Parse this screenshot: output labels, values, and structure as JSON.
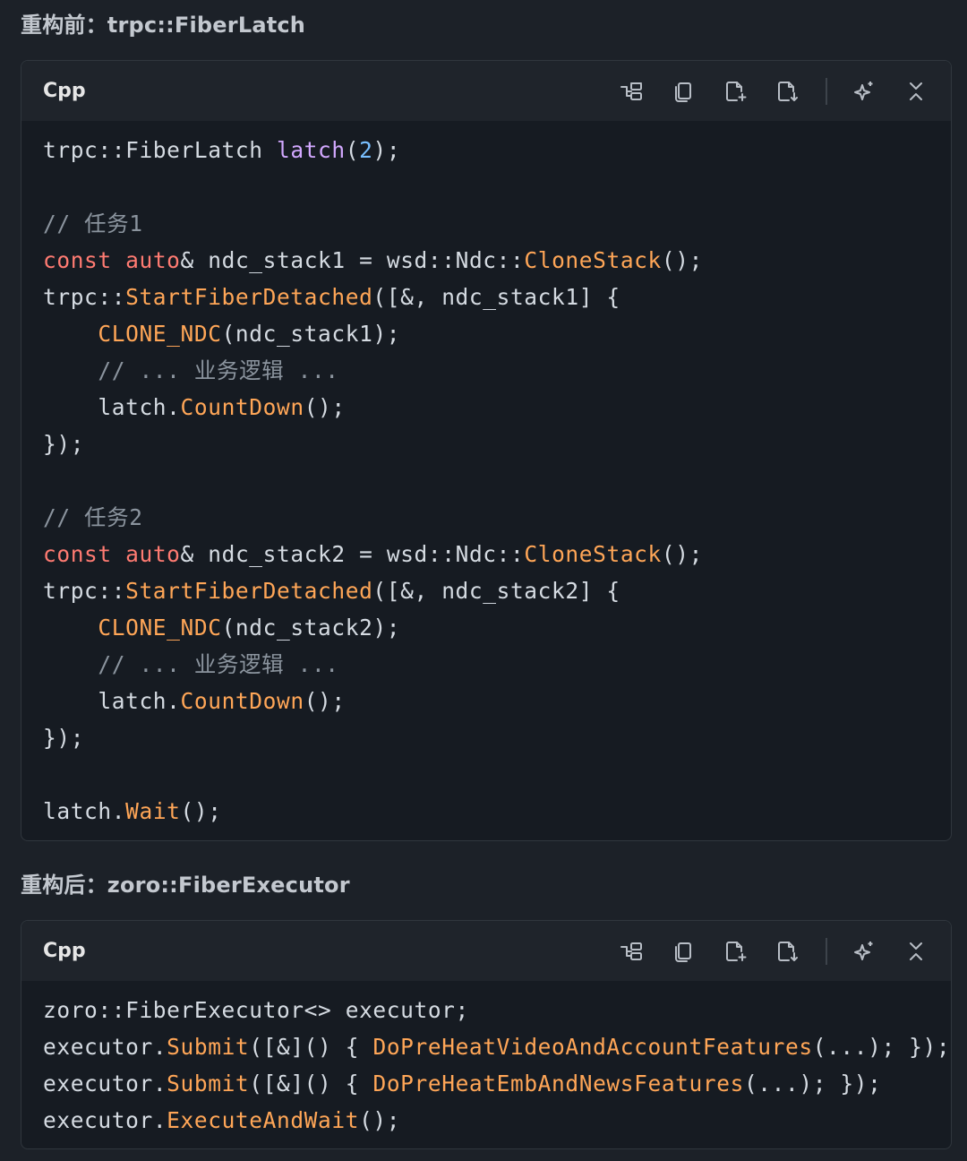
{
  "section1": {
    "title": "重构前：trpc::FiberLatch"
  },
  "section2": {
    "title": "重构后：zoro::FiberExecutor"
  },
  "code_block": {
    "language": "Cpp",
    "toolbar_icons": [
      "outline-icon",
      "copy-icon",
      "insert-file-icon",
      "download-file-icon",
      "sparkle-icon",
      "collapse-icon"
    ]
  },
  "colors": {
    "background": "#1c2128",
    "code_background": "#161b22",
    "keyword": "#ff7b72",
    "function": "#ffa657",
    "type": "#d2a8ff",
    "number": "#79c0ff",
    "comment": "#8b949e"
  },
  "code1": [
    {
      "t": "trpc::FiberLatch latch(2);"
    },
    {
      "t": ""
    },
    {
      "t": "// 任务1"
    },
    {
      "t": "const auto& ndc_stack1 = wsd::Ndc::CloneStack();"
    },
    {
      "t": "trpc::StartFiberDetached([&, ndc_stack1] {"
    },
    {
      "t": "    CLONE_NDC(ndc_stack1);"
    },
    {
      "t": "    // ... 业务逻辑 ..."
    },
    {
      "t": "    latch.CountDown();"
    },
    {
      "t": "});"
    },
    {
      "t": ""
    },
    {
      "t": "// 任务2"
    },
    {
      "t": "const auto& ndc_stack2 = wsd::Ndc::CloneStack();"
    },
    {
      "t": "trpc::StartFiberDetached([&, ndc_stack2] {"
    },
    {
      "t": "    CLONE_NDC(ndc_stack2);"
    },
    {
      "t": "    // ... 业务逻辑 ..."
    },
    {
      "t": "    latch.CountDown();"
    },
    {
      "t": "});"
    },
    {
      "t": ""
    },
    {
      "t": "latch.Wait();"
    }
  ],
  "code2": [
    {
      "t": "zoro::FiberExecutor<> executor;"
    },
    {
      "t": "executor.Submit([&]() { DoPreHeatVideoAndAccountFeatures(...); });"
    },
    {
      "t": "executor.Submit([&]() { DoPreHeatEmbAndNewsFeatures(...); });"
    },
    {
      "t": "executor.ExecuteAndWait();"
    }
  ]
}
